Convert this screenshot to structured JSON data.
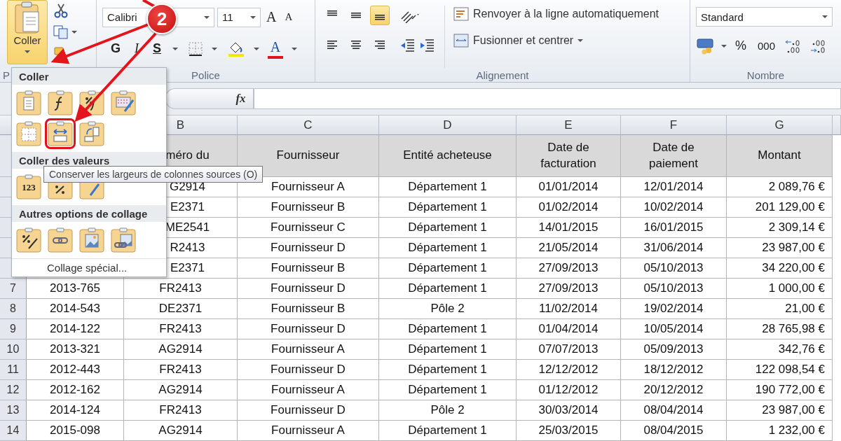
{
  "ribbon": {
    "clipboard": {
      "paste_label": "Coller",
      "group_label": "P"
    },
    "font": {
      "family": "Calibri",
      "size": "11",
      "grow": "A",
      "shrink": "A",
      "bold": "G",
      "italic": "I",
      "underline": "S",
      "font_color": "A",
      "group_label": "Police"
    },
    "alignment": {
      "vertical": [
        {
          "kind": "top",
          "selected": false
        },
        {
          "kind": "middle",
          "selected": false
        },
        {
          "kind": "bottom",
          "selected": true
        }
      ],
      "horizontal": [
        {
          "kind": "left",
          "selected": false
        },
        {
          "kind": "center",
          "selected": false
        },
        {
          "kind": "right",
          "selected": false
        }
      ],
      "wrap_text": "Renvoyer à la ligne automatiquement",
      "merge": "Fusionner et centrer",
      "group_label": "Alignement"
    },
    "number": {
      "format": "Standard",
      "percent": "%",
      "thousands": "000",
      "group_label": "Nombre"
    }
  },
  "formula_bar": {
    "fx": "fx"
  },
  "column_letters": {
    "B": "B",
    "C": "C",
    "D": "D",
    "E": "E",
    "F": "F",
    "G": "G"
  },
  "header_row": {
    "cells": {
      "B": "méro du",
      "C": "Fournisseur",
      "D": "Entité acheteuse",
      "E": "Date de facturation",
      "F": "Date de paiement",
      "G": "Montant"
    }
  },
  "rows": [
    {
      "cells": {
        "B": "G2914",
        "C": "Fournisseur A",
        "D": "Département 1",
        "E": "01/01/2014",
        "F": "12/01/2014",
        "G": "2 089,76 €"
      }
    },
    {
      "cells": {
        "B": "E2371",
        "C": "Fournisseur B",
        "D": "Département 1",
        "E": "01/02/2014",
        "F": "10/02/2014",
        "G": "201 129,00 €"
      }
    },
    {
      "cells": {
        "B": "ME2541",
        "C": "Fournisseur C",
        "D": "Département 1",
        "E": "14/01/2015",
        "F": "16/01/2015",
        "G": "2 309,14 €"
      }
    },
    {
      "cells": {
        "B": "R2413",
        "C": "Fournisseur D",
        "D": "Département 1",
        "E": "21/05/2014",
        "F": "31/06/2014",
        "G": "23 987,00 €"
      }
    },
    {
      "cells": {
        "B": "E2371",
        "C": "Fournisseur B",
        "D": "Département 1",
        "E": "27/09/2013",
        "F": "05/10/2013",
        "G": "34 220,00 €"
      }
    },
    {
      "number": "7",
      "cells": {
        "A": "2013-765",
        "B": "FR2413",
        "C": "Fournisseur D",
        "D": "Département 1",
        "E": "27/09/2013",
        "F": "05/10/2013",
        "G": "1 000,00 €"
      }
    },
    {
      "number": "8",
      "cells": {
        "A": "2014-543",
        "B": "DE2371",
        "C": "Fournisseur B",
        "D": "Pôle 2",
        "E": "11/02/2014",
        "F": "19/02/2014",
        "G": "21,00 €"
      }
    },
    {
      "number": "9",
      "cells": {
        "A": "2014-122",
        "B": "FR2413",
        "C": "Fournisseur D",
        "D": "Département 1",
        "E": "01/04/2014",
        "F": "10/05/2014",
        "G": "28 765,98 €"
      }
    },
    {
      "number": "10",
      "cells": {
        "A": "2013-321",
        "B": "AG2914",
        "C": "Fournisseur A",
        "D": "Département 1",
        "E": "07/07/2013",
        "F": "05/09/2013",
        "G": "342,76 €"
      }
    },
    {
      "number": "11",
      "cells": {
        "A": "2012-443",
        "B": "FR2413",
        "C": "Fournisseur D",
        "D": "Département 1",
        "E": "12/12/2012",
        "F": "18/12/2012",
        "G": "122 098,54 €"
      }
    },
    {
      "number": "12",
      "cells": {
        "A": "2012-162",
        "B": "AG2914",
        "C": "Fournisseur A",
        "D": "Département 1",
        "E": "01/12/2012",
        "F": "20/12/2012",
        "G": "190 772,00 €"
      }
    },
    {
      "number": "13",
      "cells": {
        "A": "2014-124",
        "B": "FR2413",
        "C": "Fournisseur D",
        "D": "Pôle 2",
        "E": "30/03/2014",
        "F": "08/04/2014",
        "G": "23 987,00 €"
      }
    },
    {
      "number": "14",
      "cells": {
        "A": "2015-098",
        "B": "AG2914",
        "C": "Fournisseur A",
        "D": "Département 1",
        "E": "25/03/2015",
        "F": "08/04/2015",
        "G": "1 232,00 €"
      }
    }
  ],
  "paste_menu": {
    "sections": [
      {
        "title": "Coller",
        "options": [
          {
            "kind": "paste",
            "selected": false
          },
          {
            "kind": "formulas",
            "selected": false
          },
          {
            "kind": "formulas-number-format",
            "selected": false
          },
          {
            "kind": "keep-formatting",
            "selected": false
          },
          {
            "kind": "no-borders",
            "selected": false
          },
          {
            "kind": "keep-column-widths",
            "selected": true
          },
          {
            "kind": "transpose",
            "selected": false
          }
        ]
      },
      {
        "title": "Coller des valeurs",
        "options": [
          {
            "kind": "values",
            "label": "123",
            "selected": false
          },
          {
            "kind": "values-number-format",
            "selected": false
          },
          {
            "kind": "values-formatting",
            "selected": false
          }
        ]
      },
      {
        "title": "Autres options de collage",
        "options": [
          {
            "kind": "formatting",
            "selected": false
          },
          {
            "kind": "link",
            "selected": false
          },
          {
            "kind": "picture",
            "selected": false
          },
          {
            "kind": "linked-picture",
            "selected": false
          }
        ]
      }
    ],
    "special": "Collage spécial..."
  },
  "tooltip": "Conserver les largeurs de colonnes sources (O)",
  "step_badge": "2"
}
